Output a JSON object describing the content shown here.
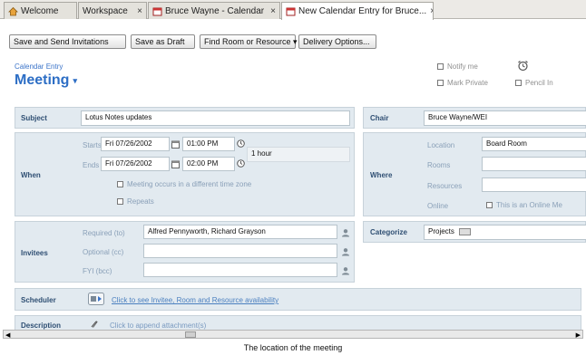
{
  "tabs": [
    {
      "label": "Welcome",
      "icon": "home-icon"
    },
    {
      "label": "Workspace",
      "close": "×"
    },
    {
      "label": "Bruce Wayne - Calendar",
      "close": "×",
      "icon": "calendar-icon"
    },
    {
      "label": "New Calendar Entry for Bruce...",
      "close": "×",
      "icon": "calendar-icon"
    }
  ],
  "toolbar": {
    "save_send": "Save and Send Invitations",
    "save_draft": "Save as Draft",
    "find_room": "Find Room or Resource ▾",
    "delivery": "Delivery Options..."
  },
  "header": {
    "small": "Calendar Entry",
    "title": "Meeting",
    "caret": "▾"
  },
  "options": {
    "notify": "Notify me",
    "mark_private": "Mark Private",
    "pencil_in": "Pencil In"
  },
  "subject": {
    "label": "Subject",
    "value": "Lotus Notes updates"
  },
  "chair": {
    "label": "Chair",
    "value": "Bruce Wayne/WEI"
  },
  "when": {
    "label": "When",
    "starts_label": "Starts",
    "ends_label": "Ends",
    "start_date": "Fri 07/26/2002",
    "start_time": "01:00 PM",
    "end_date": "Fri 07/26/2002",
    "end_time": "02:00 PM",
    "duration": "1 hour",
    "diff_tz": "Meeting occurs in a different time zone",
    "repeats": "Repeats"
  },
  "where": {
    "label": "Where",
    "location_label": "Location",
    "location_value": "Board Room",
    "rooms_label": "Rooms",
    "resources_label": "Resources",
    "online_label": "Online",
    "online_option": "This is an Online Me"
  },
  "invitees": {
    "label": "Invitees",
    "required_label": "Required (to)",
    "required_value": "Alfred Pennyworth, Richard Grayson",
    "optional_label": "Optional (cc)",
    "fyi_label": "FYI (bcc)"
  },
  "categorize": {
    "label": "Categorize",
    "value": "Projects"
  },
  "scheduler": {
    "label": "Scheduler",
    "link": "Click to see Invitee, Room and Resource availability"
  },
  "description": {
    "label": "Description",
    "link": "Click to append attachment(s)"
  },
  "caption": "The location of the meeting",
  "colors": {
    "accent": "#2d6ec5",
    "row_bg": "#e2eaf0",
    "label": "#2f4f73"
  }
}
